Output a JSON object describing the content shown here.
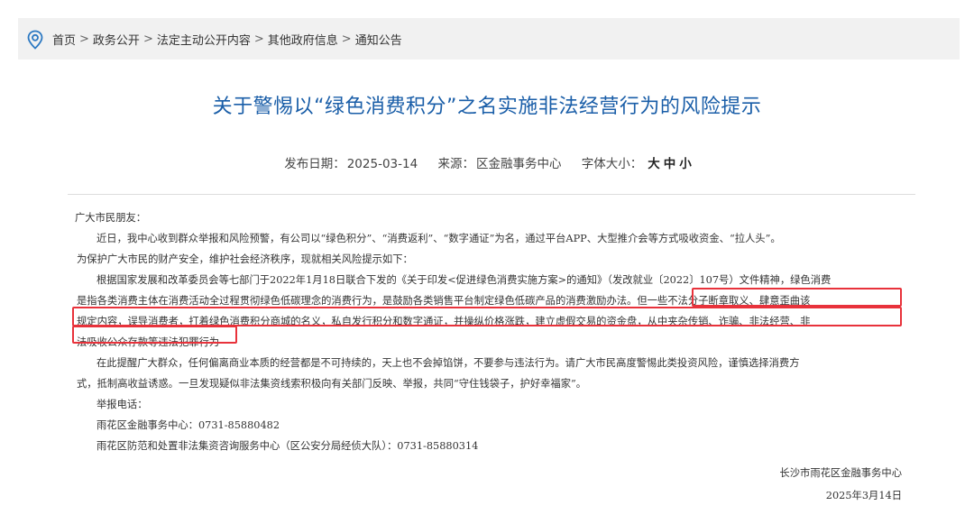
{
  "breadcrumb": {
    "items": [
      "首页",
      "政务公开",
      "法定主动公开内容",
      "其他政府信息",
      "通知公告"
    ],
    "separator": ">"
  },
  "article": {
    "title": "关于警惕以“绿色消费积分”之名实施非法经营行为的风险提示",
    "meta": {
      "date_label": "发布日期：",
      "date": "2025-03-14",
      "source_label": "来源：",
      "source": "区金融事务中心",
      "fontsize_label": "字体大小：",
      "size_large": "大",
      "size_medium": "中",
      "size_small": "小"
    },
    "greeting": "广大市民朋友：",
    "para1_line1": "近日，我中心收到群众举报和风险预警，有公司以“绿色积分”、“消费返利”、“数字通证”为名，通过平台APP、大型推介会等方式吸收资金、“拉人头”。",
    "para1_line2": "为保护广大市民的财产安全，维护社会经济秩序，现就相关风险提示如下：",
    "para2_line1": "根据国家发展和改革委员会等七部门于2022年1月18日联合下发的《关于印发<促进绿色消费实施方案>的通知》（发改就业〔2022〕107号）文件精神，绿色消费",
    "para2_line2a": "是指各类消费主体在消费活动全过程贯彻绿色低碳理念的消费行为，是鼓励各类销售平台制定绿色低碳产品的消费激励办法。",
    "para2_line2b": "但一些不法分子断章取义、肆意歪曲该",
    "para2_line3": "规定内容，误导消费者，打着绿色消费积分商城的名义，私自发行积分和数字通证，并操纵价格涨跌，建立虚假交易的资金盘，从中夹杂传销、诈骗、非法经营、非",
    "para2_line4": "法吸收公众存款等违法犯罪行为",
    "para3_line1": "在此提醒广大群众，任何偏离商业本质的经营都是不可持续的，天上也不会掉馅饼，不要参与违法行为。请广大市民高度警惕此类投资风险，谨慎选择消费方",
    "para3_line2": "式，抵制高收益诱惑。一旦发现疑似非法集资线索积极向有关部门反映、举报，共同“守住钱袋子，护好幸福家”。",
    "report_label": "举报电话：",
    "report_line1": "雨花区金融事务中心：0731-85880482",
    "report_line2": "雨花区防范和处置非法集资咨询服务中心（区公安分局经侦大队）：0731-85880314",
    "signature_org": "长沙市雨花区金融事务中心",
    "signature_date": "2025年3月14日"
  },
  "colors": {
    "title": "#1a5ea8",
    "highlight_border": "#e8323b",
    "breadcrumb_bg": "#f1f1f1"
  },
  "icons": {
    "location": "location-pin-icon"
  }
}
